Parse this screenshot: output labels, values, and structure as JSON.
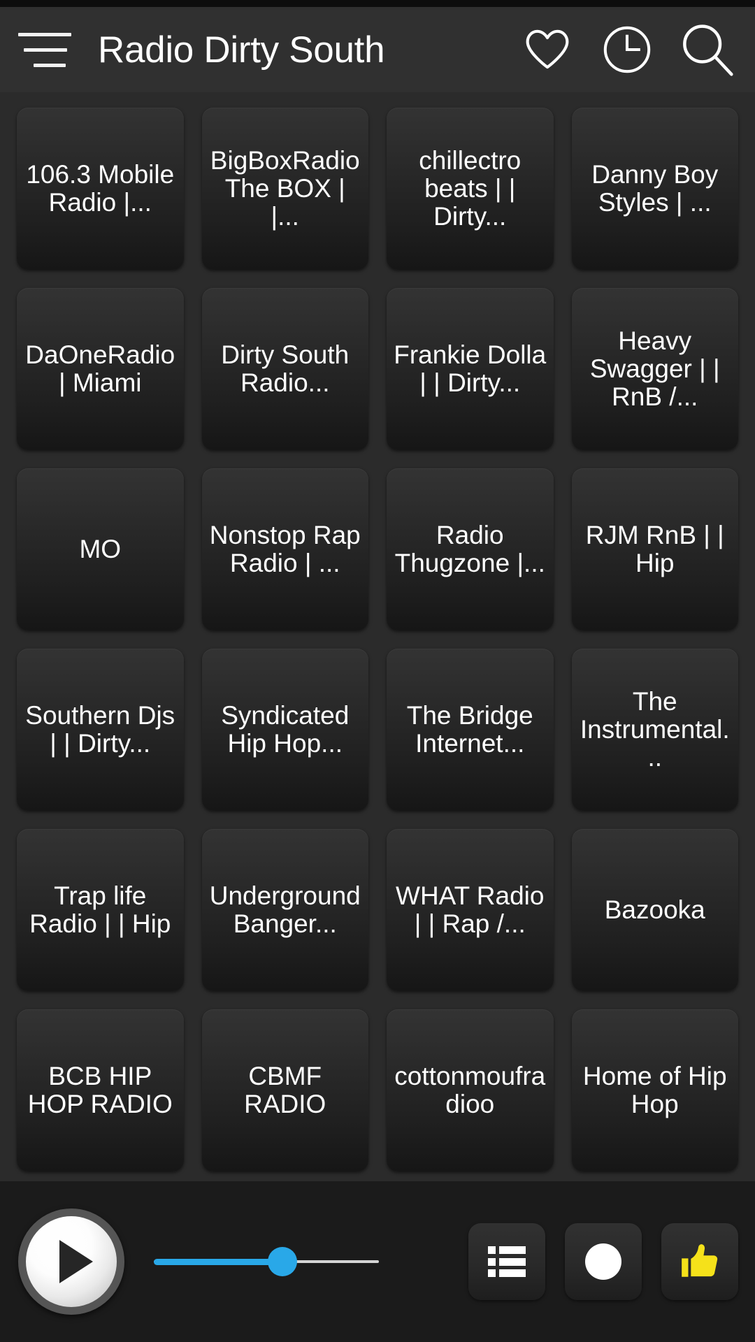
{
  "app": {
    "title": "Radio Dirty South",
    "accent_blue": "#29a8e8",
    "thumb_yellow": "#f5e11a",
    "background": "#2b2b2b"
  },
  "header": {
    "menu_icon": "hamburger-menu-icon",
    "title": "Radio Dirty South",
    "actions": [
      {
        "name": "favorites-button",
        "icon": "heart-icon"
      },
      {
        "name": "history-button",
        "icon": "clock-icon"
      },
      {
        "name": "search-button",
        "icon": "search-icon"
      }
    ]
  },
  "stations": [
    {
      "label": "106.3 Mobile Radio |..."
    },
    {
      "label": "BigBoxRadio The BOX | |..."
    },
    {
      "label": "chillectro beats | | Dirty..."
    },
    {
      "label": "Danny Boy Styles | ..."
    },
    {
      "label": "DaOneRadio | Miami"
    },
    {
      "label": "Dirty South Radio..."
    },
    {
      "label": "Frankie Dolla | | Dirty..."
    },
    {
      "label": "Heavy Swagger | | RnB /..."
    },
    {
      "label": "MO"
    },
    {
      "label": "Nonstop Rap Radio | ..."
    },
    {
      "label": "Radio Thugzone |..."
    },
    {
      "label": "RJM RnB | | Hip"
    },
    {
      "label": "Southern Djs | | Dirty..."
    },
    {
      "label": "Syndicated Hip Hop..."
    },
    {
      "label": "The Bridge Internet..."
    },
    {
      "label": "The Instrumental..."
    },
    {
      "label": "Trap life Radio | | Hip"
    },
    {
      "label": "Underground Banger..."
    },
    {
      "label": "WHAT Radio | | Rap /..."
    },
    {
      "label": "Bazooka"
    },
    {
      "label": "BCB HIP HOP RADIO"
    },
    {
      "label": "CBMF RADIO"
    },
    {
      "label": "cottonmoufradioo"
    },
    {
      "label": "Home of Hip Hop"
    }
  ],
  "player": {
    "play_button": "play-button",
    "volume": {
      "name": "volume-slider",
      "value_percent": 57
    },
    "actions": [
      {
        "name": "playlist-button",
        "icon": "list-icon"
      },
      {
        "name": "record-button",
        "icon": "record-dot-icon"
      },
      {
        "name": "like-button",
        "icon": "thumbs-up-icon"
      }
    ]
  }
}
